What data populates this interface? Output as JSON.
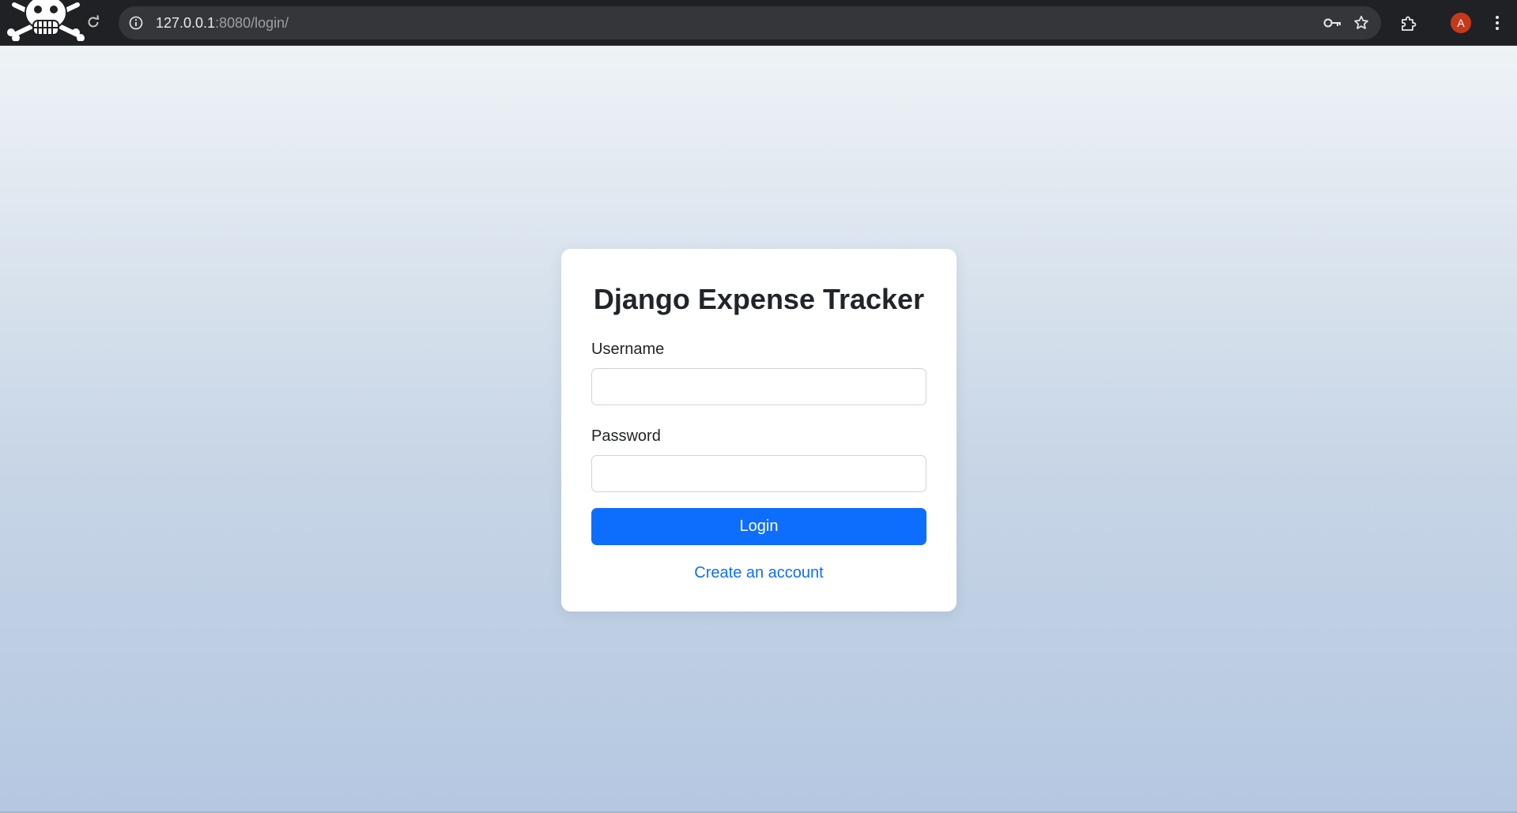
{
  "browser": {
    "url_host": "127.0.0.1",
    "url_path": ":8080/login/",
    "profile_initial": "A",
    "icons": {
      "tab_logo": "jolly-roger-skull-icon",
      "reload": "reload-icon",
      "site_info": "info-icon",
      "password_key": "key-icon",
      "bookmark": "star-icon",
      "extensions": "puzzle-piece-icon",
      "menu": "vertical-dots-icon"
    },
    "colors": {
      "toolbar_bg": "#202124",
      "omnibox_bg": "#35363a",
      "avatar_bg": "#c5391a"
    }
  },
  "login_page": {
    "title": "Django Expense Tracker",
    "username_label": "Username",
    "username_value": "",
    "password_label": "Password",
    "password_value": "",
    "submit_label": "Login",
    "signup_link": "Create an account",
    "colors": {
      "primary": "#0d6efd",
      "card_bg": "#ffffff",
      "text": "#212529"
    }
  }
}
